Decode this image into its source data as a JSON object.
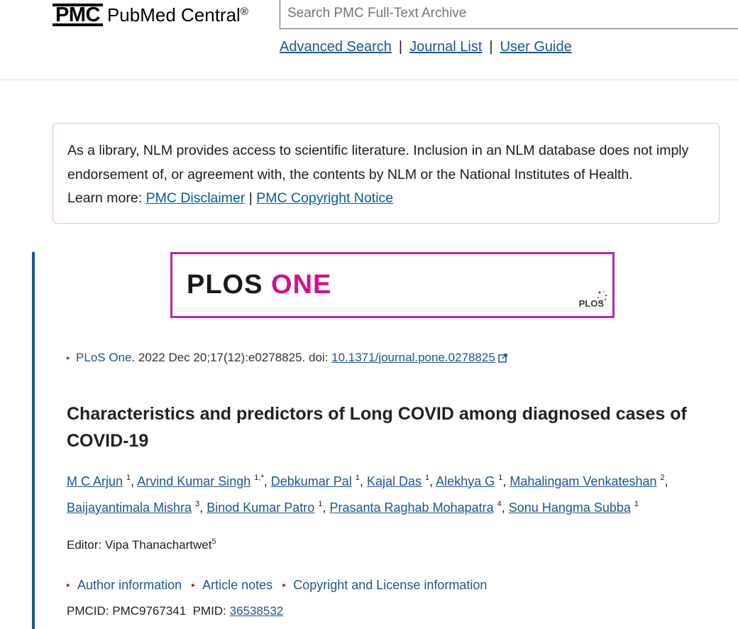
{
  "header": {
    "logo_abbrev": "PMC",
    "logo_name": "PubMed Central",
    "logo_mark": "®",
    "search_placeholder": "Search PMC Full-Text Archive",
    "links": [
      "Advanced Search",
      "Journal List",
      "User Guide"
    ],
    "separator": "|"
  },
  "disclaimer": {
    "text": "As a library, NLM provides access to scientific literature. Inclusion in an NLM database does not imply endorsement of, or agreement with, the contents by NLM or the National Institutes of Health.",
    "learn_more": "Learn more:",
    "link1": "PMC Disclaimer",
    "divider": "|",
    "link2": "PMC Copyright Notice"
  },
  "banner": {
    "plos": "PLOS",
    "one": "ONE",
    "mini_logo": "PLOS"
  },
  "citation": {
    "journal": "PLoS One",
    "details": ". 2022 Dec 20;17(12):e0278825. doi: ",
    "doi": "10.1371/journal.pone.0278825"
  },
  "article": {
    "title": "Characteristics and predictors of Long COVID among diagnosed cases of COVID-19",
    "authors": [
      {
        "name": "M C Arjun",
        "aff": "1"
      },
      {
        "name": "Arvind Kumar Singh",
        "aff": "1,*"
      },
      {
        "name": "Debkumar Pal",
        "aff": "1"
      },
      {
        "name": "Kajal Das",
        "aff": "1"
      },
      {
        "name": "Alekhya G",
        "aff": "1"
      },
      {
        "name": "Mahalingam Venkateshan",
        "aff": "2"
      },
      {
        "name": "Baijayantimala Mishra",
        "aff": "3"
      },
      {
        "name": "Binod Kumar Patro",
        "aff": "1"
      },
      {
        "name": "Prasanta Raghab Mohapatra",
        "aff": "4"
      },
      {
        "name": "Sonu Hangma Subba",
        "aff": "1"
      }
    ],
    "editor_label": "Editor: ",
    "editor": "Vipa Thanachartwet",
    "editor_aff": "5"
  },
  "accordions": [
    "Author information",
    "Article notes",
    "Copyright and License information"
  ],
  "ids": {
    "pmcid_label": "PMCID: ",
    "pmcid": "PMC9767341",
    "pmid_label": "PMID: ",
    "pmid": "36538532"
  },
  "colors": {
    "link": "#205493",
    "accent_bar": "#205493",
    "banner_border": "#b626b0",
    "plos_one": "#d1108c",
    "accordion_marker": "#d10000"
  }
}
